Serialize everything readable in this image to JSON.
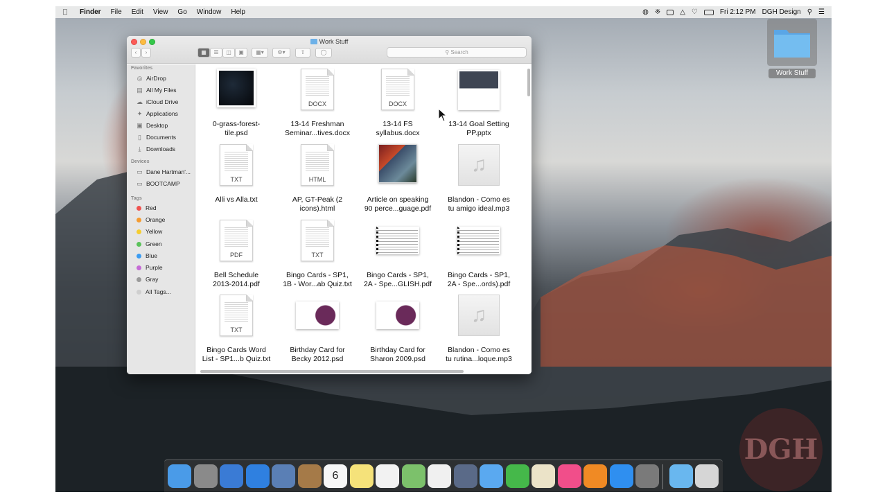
{
  "menubar": {
    "app_name": "Finder",
    "items": [
      "File",
      "Edit",
      "View",
      "Go",
      "Window",
      "Help"
    ],
    "clock": "Fri 2:12 PM",
    "user": "DGH Design"
  },
  "desktop": {
    "folder_label": "Work Stuff",
    "watermark": "DGH"
  },
  "window": {
    "title": "Work Stuff",
    "search_placeholder": "Search"
  },
  "sidebar": {
    "favorites_header": "Favorites",
    "favorites": [
      {
        "label": "AirDrop",
        "icon": "airdrop-icon"
      },
      {
        "label": "All My Files",
        "icon": "all-files-icon"
      },
      {
        "label": "iCloud Drive",
        "icon": "cloud-icon"
      },
      {
        "label": "Applications",
        "icon": "applications-icon"
      },
      {
        "label": "Desktop",
        "icon": "desktop-icon"
      },
      {
        "label": "Documents",
        "icon": "documents-icon"
      },
      {
        "label": "Downloads",
        "icon": "downloads-icon"
      }
    ],
    "devices_header": "Devices",
    "devices": [
      {
        "label": "Dane Hartman'...",
        "icon": "computer-icon"
      },
      {
        "label": "BOOTCAMP",
        "icon": "drive-icon"
      }
    ],
    "tags_header": "Tags",
    "tags": [
      {
        "label": "Red",
        "color": "#f0524f"
      },
      {
        "label": "Orange",
        "color": "#f59b30"
      },
      {
        "label": "Yellow",
        "color": "#f5cd2f"
      },
      {
        "label": "Green",
        "color": "#5ac25a"
      },
      {
        "label": "Blue",
        "color": "#3b9cf2"
      },
      {
        "label": "Purple",
        "color": "#c56bd6"
      },
      {
        "label": "Gray",
        "color": "#9a9a9a"
      },
      {
        "label": "All Tags...",
        "color": "#cfcfcf"
      }
    ]
  },
  "files": [
    {
      "line1": "0-grass-forest-",
      "line2": "tile.psd",
      "kind": "image-dark"
    },
    {
      "line1": "13-14 Freshman",
      "line2": "Seminar...tives.docx",
      "kind": "doc",
      "ext": "DOCX"
    },
    {
      "line1": "13-14 FS",
      "line2": "syllabus.docx",
      "kind": "doc",
      "ext": "DOCX"
    },
    {
      "line1": "13-14 Goal Setting",
      "line2": "PP.pptx",
      "kind": "slide"
    },
    {
      "line1": "Alli vs Alla.txt",
      "line2": "",
      "kind": "doc",
      "ext": "TXT"
    },
    {
      "line1": "AP, GT-Peak (2",
      "line2": "icons).html",
      "kind": "doc",
      "ext": "HTML"
    },
    {
      "line1": "Article on speaking",
      "line2": "90 perce...guage.pdf",
      "kind": "image-cover"
    },
    {
      "line1": "Blandon - Como es",
      "line2": "tu amigo ideal.mp3",
      "kind": "music"
    },
    {
      "line1": "Bell Schedule",
      "line2": "2013-2014.pdf",
      "kind": "doc",
      "ext": "PDF"
    },
    {
      "line1": "Bingo Cards - SP1,",
      "line2": "1B - Wor...ab Quiz.txt",
      "kind": "doc",
      "ext": "TXT"
    },
    {
      "line1": "Bingo Cards - SP1,",
      "line2": "2A - Spe...GLISH.pdf",
      "kind": "wide-lines"
    },
    {
      "line1": "Bingo Cards - SP1,",
      "line2": "2A - Spe...ords).pdf",
      "kind": "wide-lines"
    },
    {
      "line1": "Bingo Cards Word",
      "line2": "List - SP1...b Quiz.txt",
      "kind": "doc",
      "ext": "TXT"
    },
    {
      "line1": "Birthday Card for",
      "line2": "Becky 2012.psd",
      "kind": "wide-card"
    },
    {
      "line1": "Birthday Card for",
      "line2": "Sharon 2009.psd",
      "kind": "wide-card"
    },
    {
      "line1": "Blandon - Como es",
      "line2": "tu rutina...loque.mp3",
      "kind": "music"
    }
  ],
  "dock": {
    "apps": [
      {
        "name": "finder-icon",
        "color": "#4a9be8"
      },
      {
        "name": "launchpad-icon",
        "color": "#8a8a8a"
      },
      {
        "name": "system-disk-icon",
        "color": "#3a7bd5"
      },
      {
        "name": "safari-icon",
        "color": "#2f80e0"
      },
      {
        "name": "preview-icon",
        "color": "#5a7fb5"
      },
      {
        "name": "contacts-icon",
        "color": "#a57a48"
      },
      {
        "name": "calendar-icon",
        "color": "#f7f7f7"
      },
      {
        "name": "notes-icon",
        "color": "#f5e27a"
      },
      {
        "name": "reminders-icon",
        "color": "#f2f2f2"
      },
      {
        "name": "maps-icon",
        "color": "#7cc16b"
      },
      {
        "name": "photos-icon",
        "color": "#f0f0f0"
      },
      {
        "name": "imovie-icon",
        "color": "#5a6a88"
      },
      {
        "name": "messages-icon",
        "color": "#5aa9f0"
      },
      {
        "name": "facetime-icon",
        "color": "#45b84a"
      },
      {
        "name": "textedit-icon",
        "color": "#ebe3c8"
      },
      {
        "name": "itunes-icon",
        "color": "#f14e8a"
      },
      {
        "name": "ibooks-icon",
        "color": "#f08a24"
      },
      {
        "name": "app-store-icon",
        "color": "#2f8ff0"
      },
      {
        "name": "system-preferences-icon",
        "color": "#7a7a7a"
      },
      {
        "name": "downloads-stack-icon",
        "color": "#69b7ef"
      },
      {
        "name": "trash-icon",
        "color": "#d6d6d6"
      }
    ],
    "calendar_day": "6"
  }
}
